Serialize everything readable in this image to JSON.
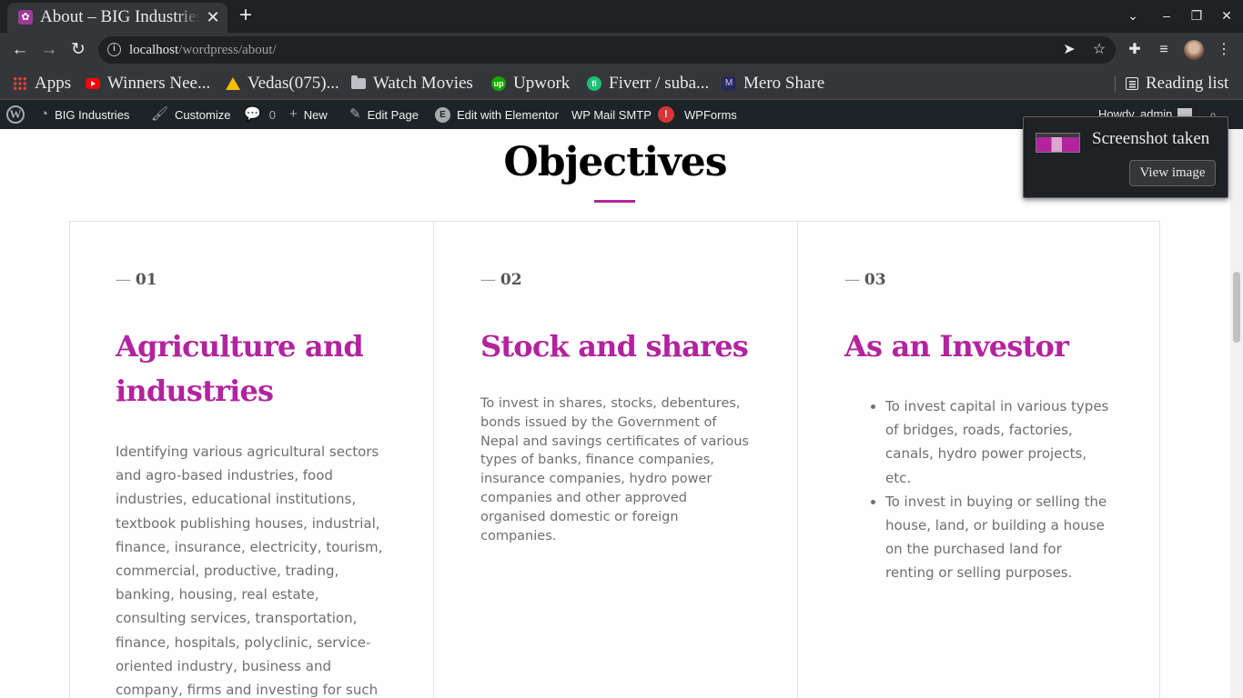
{
  "browser": {
    "tab": {
      "title": "About – BIG Industries",
      "close_glyph": "✕"
    },
    "new_tab_glyph": "+",
    "window_controls": {
      "list_glyph": "⌄",
      "minimize_glyph": "–",
      "restore_glyph": "❐",
      "close_glyph": "✕"
    },
    "nav": {
      "back_glyph": "←",
      "forward_glyph": "→",
      "reload_glyph": "↻"
    },
    "url": {
      "host": "localhost",
      "path": "/wordpress/about/"
    },
    "omnibox_icons": [
      "send-icon",
      "bookmark-star-icon"
    ],
    "toolbar_icons": [
      "extensions-icon",
      "media-queue-icon",
      "profile-avatar"
    ],
    "bookmarks": [
      {
        "label": "Apps",
        "icon": "apps-grid-icon"
      },
      {
        "label": "Winners Nee...",
        "icon": "youtube-icon"
      },
      {
        "label": "Vedas(075)...",
        "icon": "google-drive-icon"
      },
      {
        "label": "Watch Movies",
        "icon": "folder-icon"
      },
      {
        "label": "Upwork",
        "icon": "upwork-icon"
      },
      {
        "label": "Fiverr / suba...",
        "icon": "fiverr-icon"
      },
      {
        "label": "Mero Share",
        "icon": "mero-share-icon"
      }
    ],
    "reading_list": "Reading list"
  },
  "admin_bar": {
    "site_name": "BIG Industries",
    "customize": "Customize",
    "comments_count": "0",
    "new": "New",
    "edit_page": "Edit Page",
    "edit_with_elementor": "Edit with Elementor",
    "wp_mail_smtp": "WP Mail SMTP",
    "smtp_badge": "!",
    "wpforms": "WPForms",
    "howdy": "Howdy, admin"
  },
  "page": {
    "section_title": "Objectives",
    "accent_color": "#b3239e",
    "cards": [
      {
        "number": "01",
        "title_line1": "Agriculture and",
        "title_line2": "industries",
        "body": "Identifying various agricultural sectors and agro-based industries, food industries, educational institutions, textbook publishing houses, industrial, finance, insurance, electricity, tourism, commercial, productive, trading, banking, housing, real estate, consulting services, transportation, finance, hospitals, polyclinic, service-oriented industry, business and company, firms and investing for such industry and services as"
      },
      {
        "number": "02",
        "title_line1": "Stock and shares",
        "body": "To invest in shares, stocks, debentures, bonds issued by the Government of Nepal and savings certificates of various types of banks, finance companies, insurance companies, hydro power companies and other approved organised domestic or foreign companies."
      },
      {
        "number": "03",
        "title_line1": "As an Investor",
        "list": [
          "To invest capital in various types of bridges, roads, factories, canals, hydro power projects, etc.",
          " To invest in buying or selling the house, land, or building a house on the purchased land for renting or selling purposes."
        ]
      }
    ],
    "dash": "—"
  },
  "toast": {
    "title": "Screenshot taken",
    "button": "View image"
  }
}
